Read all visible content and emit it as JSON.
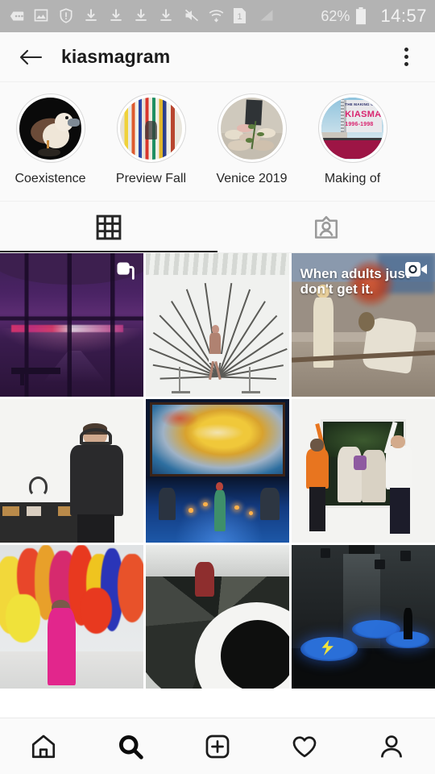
{
  "status_bar": {
    "icons": [
      "message-dots-icon",
      "image-icon",
      "shield-alert-icon",
      "download-icon",
      "download-icon",
      "download-icon",
      "download-icon",
      "mute-icon",
      "wifi-icon",
      "sim-1-icon",
      "signal-icon"
    ],
    "sim_label": "1",
    "battery_percent": "62%",
    "time": "14:57"
  },
  "header": {
    "back_label": "Back",
    "title": "kiasmagram",
    "menu_label": "More options"
  },
  "highlights": [
    {
      "label": "Coexistence",
      "art": "bird"
    },
    {
      "label": "Preview Fall",
      "art": "stripes"
    },
    {
      "label": "Venice 2019",
      "art": "stones"
    },
    {
      "label": "Making of",
      "art": "billboard"
    }
  ],
  "billboard": {
    "line1": "THE MAKING OF",
    "line2": "KIASMA",
    "line3": "1996-1998"
  },
  "tabs": [
    {
      "name": "grid",
      "icon": "grid-icon",
      "active": true
    },
    {
      "name": "tagged",
      "icon": "tagged-person-icon",
      "active": false
    }
  ],
  "posts": [
    {
      "id": 1,
      "art": "c1",
      "badge": "carousel",
      "alt": "Purple window view at dusk"
    },
    {
      "id": 2,
      "art": "c2",
      "badge": "none",
      "alt": "Wire tree sculpture with figure"
    },
    {
      "id": 3,
      "art": "c3",
      "badge": "video",
      "caption": "When adults just don't get it.",
      "alt": "Painting of children with overlay text"
    },
    {
      "id": 4,
      "art": "c4",
      "badge": "none",
      "alt": "Visitor with headphones in gallery"
    },
    {
      "id": 5,
      "art": "c5",
      "badge": "none",
      "alt": "Stage performance with projection"
    },
    {
      "id": 6,
      "art": "c6",
      "badge": "none",
      "alt": "Two people hanging an artwork"
    },
    {
      "id": 7,
      "art": "c7",
      "badge": "none",
      "alt": "Colorful feather installation with pink figure"
    },
    {
      "id": 8,
      "art": "c8",
      "badge": "none",
      "alt": "Spiral staircase from below"
    },
    {
      "id": 9,
      "art": "c9",
      "badge": "none",
      "alt": "Dark room with blue floor projections"
    }
  ],
  "bottom_nav": [
    {
      "name": "home",
      "icon": "home-icon",
      "active": false
    },
    {
      "name": "search",
      "icon": "search-icon",
      "active": true
    },
    {
      "name": "create",
      "icon": "plus-square-icon",
      "active": false
    },
    {
      "name": "activity",
      "icon": "heart-icon",
      "active": false
    },
    {
      "name": "profile",
      "icon": "person-icon",
      "active": false
    }
  ],
  "colors": {
    "statusbar_bg": "#b3b3b3",
    "app_bg": "#fafafa",
    "text": "#262626",
    "divider": "#efefef",
    "accent": "#262626"
  }
}
